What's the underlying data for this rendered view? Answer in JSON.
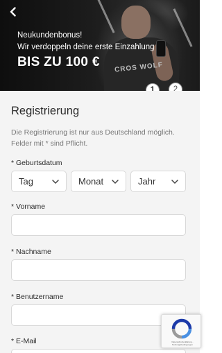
{
  "hero": {
    "line1": "Neukundenbonus!",
    "line2": "Wir verdoppeln deine erste Einzahlung",
    "headline": "BIS ZU 100 €",
    "shirt_text": "CROS WOLF",
    "steps": [
      "1",
      "2"
    ]
  },
  "form": {
    "title": "Registrierung",
    "note": "Die Registrierung ist nur aus Deutschland möglich. Felder mit * sind Pflicht.",
    "birthdate_label": "Geburtsdatum",
    "day_placeholder": "Tag",
    "month_placeholder": "Monat",
    "year_placeholder": "Jahr",
    "firstname_label": "Vorname",
    "lastname_label": "Nachname",
    "username_label": "Benutzername",
    "email_label": "E-Mail",
    "required_marker": "*"
  },
  "recaptcha": {
    "text": "Datenschutzerklärung - Nutzungsbedingungen"
  },
  "colors": {
    "form_background": "#f4f4f4",
    "hero_background": "#171717",
    "input_border": "#d8d8d8"
  }
}
